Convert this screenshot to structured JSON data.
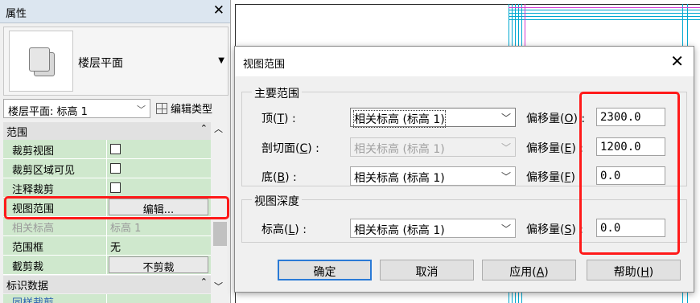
{
  "properties_panel": {
    "title": "属性",
    "close_label": "✕",
    "type_name": "楼层平面",
    "instance_selector": "楼层平面: 标高 1",
    "edit_type_label": "编辑类型",
    "groups": [
      {
        "label": "范围",
        "chevron": "⌃"
      },
      {
        "label": "标识数据",
        "chevron": "⌃"
      }
    ],
    "rows": [
      {
        "key": "裁剪视图",
        "value_kind": "checkbox"
      },
      {
        "key": "裁剪区域可见",
        "value_kind": "checkbox"
      },
      {
        "key": "注释裁剪",
        "value_kind": "checkbox"
      },
      {
        "key": "视图范围",
        "button": "编辑..."
      },
      {
        "key": "相关标高",
        "value": "标高 1",
        "disabled": true
      },
      {
        "key": "范围框",
        "value": "无"
      },
      {
        "key": "截剪裁",
        "button": "不剪裁"
      }
    ],
    "bottom_row_partial": "同样裁剪"
  },
  "dialog": {
    "title": "视图范围",
    "close_label": "✕",
    "primary_range": {
      "legend": "主要范围",
      "rows": [
        {
          "label": "顶(",
          "key": "T",
          "suffix": ") :",
          "level": "相关标高 (标高 1)",
          "offset_label": "偏移量(",
          "offset_key": "O",
          "offset_value": "2300.0"
        },
        {
          "label": "剖切面(",
          "key": "C",
          "suffix": ") :",
          "level": "相关标高 (标高 1)",
          "offset_label": "偏移量(",
          "offset_key": "E",
          "offset_value": "1200.0"
        },
        {
          "label": "底(",
          "key": "B",
          "suffix": ") :",
          "level": "相关标高 (标高 1)",
          "offset_label": "偏移量(",
          "offset_key": "F",
          "offset_value": "0.0"
        }
      ]
    },
    "view_depth": {
      "legend": "视图深度",
      "label": "标高(",
      "key": "L",
      "suffix": ") :",
      "level": "相关标高 (标高 1)",
      "offset_label": "偏移量(",
      "offset_key": "S",
      "offset_value": "0.0"
    },
    "buttons": {
      "ok": "确定",
      "cancel": "取消",
      "apply": "应用(",
      "apply_key": "A",
      "help": "帮助(",
      "help_key": "H"
    }
  },
  "colors": {
    "highlight": "#ff1a1a",
    "property_bg": "#cfe8cd",
    "plan_lines": "#00a8d0"
  },
  "icons": {
    "floor_plan": "floor-plan-icon",
    "edit_type": "edit-type-icon"
  }
}
